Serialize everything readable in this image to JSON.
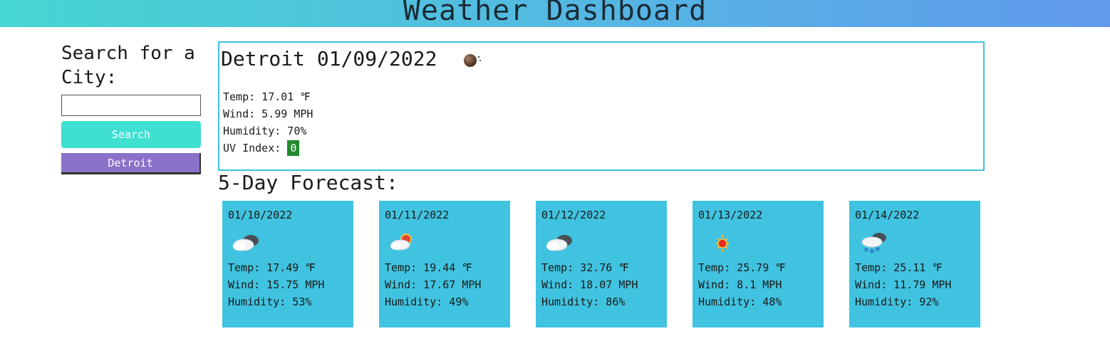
{
  "header": {
    "title": "Weather Dashboard"
  },
  "sidebar": {
    "search_title": "Search for a City:",
    "search_input_value": "",
    "search_button_label": "Search",
    "history": [
      "Detroit"
    ]
  },
  "current": {
    "title": "Detroit 01/09/2022",
    "icon": "night-icon",
    "temp": "Temp: 17.01 ℉",
    "wind": "Wind: 5.99 MPH",
    "humidity": "Humidity: 70%",
    "uv_label": "UV Index: ",
    "uv_value": "0",
    "uv_color": "#1f8a2e"
  },
  "forecast": {
    "title": "5-Day Forecast:",
    "days": [
      {
        "date": "01/10/2022",
        "icon": "cloudy-icon",
        "temp": "Temp: 17.49 ℉",
        "wind": "Wind: 15.75 MPH",
        "humidity": "Humidity: 53%"
      },
      {
        "date": "01/11/2022",
        "icon": "partly-cloudy-icon",
        "temp": "Temp: 19.44 ℉",
        "wind": "Wind: 17.67 MPH",
        "humidity": "Humidity: 49%"
      },
      {
        "date": "01/12/2022",
        "icon": "cloudy-icon",
        "temp": "Temp: 32.76 ℉",
        "wind": "Wind: 18.07 MPH",
        "humidity": "Humidity: 86%"
      },
      {
        "date": "01/13/2022",
        "icon": "sun-icon",
        "temp": "Temp: 25.79 ℉",
        "wind": "Wind: 8.1 MPH",
        "humidity": "Humidity: 48%"
      },
      {
        "date": "01/14/2022",
        "icon": "snow-icon",
        "temp": "Temp: 25.11 ℉",
        "wind": "Wind: 11.79 MPH",
        "humidity": "Humidity: 92%"
      }
    ]
  },
  "colors": {
    "card_background": "#40c3e0",
    "search_button": "#40e0d0",
    "history_button": "#8a72c9"
  }
}
